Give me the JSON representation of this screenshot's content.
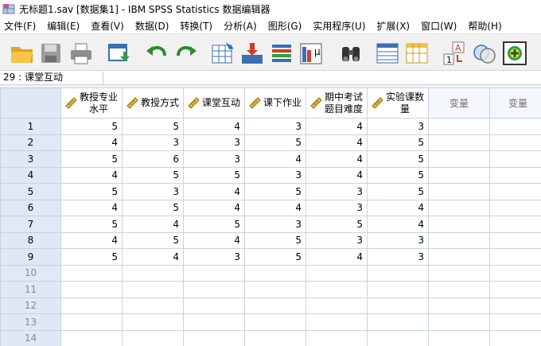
{
  "window": {
    "title": "无标题1.sav [数据集1] - IBM SPSS Statistics 数据编辑器"
  },
  "menu": [
    {
      "label": "文件(F)"
    },
    {
      "label": "编辑(E)"
    },
    {
      "label": "查看(V)"
    },
    {
      "label": "数据(D)"
    },
    {
      "label": "转换(T)"
    },
    {
      "label": "分析(A)"
    },
    {
      "label": "图形(G)"
    },
    {
      "label": "实用程序(U)"
    },
    {
      "label": "扩展(X)"
    },
    {
      "label": "窗口(W)"
    },
    {
      "label": "帮助(H)"
    }
  ],
  "toolbar": [
    {
      "icon": "open-folder-icon"
    },
    {
      "icon": "save-disk-icon"
    },
    {
      "icon": "print-icon"
    },
    {
      "icon": "recall-dialog-icon"
    },
    {
      "icon": "undo-icon"
    },
    {
      "icon": "redo-icon"
    },
    {
      "icon": "go-to-case-icon"
    },
    {
      "icon": "go-to-variable-icon"
    },
    {
      "icon": "variables-icon"
    },
    {
      "icon": "run-descriptives-icon"
    },
    {
      "icon": "find-binoculars-icon"
    },
    {
      "icon": "insert-cases-icon"
    },
    {
      "icon": "insert-variable-icon"
    },
    {
      "icon": "value-labels-icon"
    },
    {
      "icon": "use-sets-icon"
    },
    {
      "icon": "spelling-icon"
    }
  ],
  "cell_editor": {
    "reference": "29 : 课堂互动",
    "value": ""
  },
  "sheet": {
    "columns": [
      {
        "label": "教授专业\n水平",
        "scale": true
      },
      {
        "label": "教授方式",
        "scale": true
      },
      {
        "label": "课堂互动",
        "scale": true
      },
      {
        "label": "课下作业",
        "scale": true
      },
      {
        "label": "期中考试\n题目难度",
        "scale": true
      },
      {
        "label": "实验课数\n量",
        "scale": true
      },
      {
        "label": "变量",
        "scale": false
      },
      {
        "label": "变量",
        "scale": false
      }
    ],
    "rows": [
      {
        "num": "1",
        "cells": [
          "5",
          "5",
          "4",
          "3",
          "4",
          "3"
        ]
      },
      {
        "num": "2",
        "cells": [
          "4",
          "3",
          "3",
          "5",
          "4",
          "5"
        ]
      },
      {
        "num": "3",
        "cells": [
          "5",
          "6",
          "3",
          "4",
          "4",
          "5"
        ]
      },
      {
        "num": "4",
        "cells": [
          "4",
          "5",
          "5",
          "3",
          "4",
          "5"
        ]
      },
      {
        "num": "5",
        "cells": [
          "5",
          "3",
          "4",
          "5",
          "3",
          "5"
        ]
      },
      {
        "num": "6",
        "cells": [
          "4",
          "5",
          "4",
          "4",
          "3",
          "4"
        ]
      },
      {
        "num": "7",
        "cells": [
          "5",
          "4",
          "5",
          "3",
          "5",
          "4"
        ]
      },
      {
        "num": "8",
        "cells": [
          "4",
          "5",
          "4",
          "5",
          "3",
          "3"
        ]
      },
      {
        "num": "9",
        "cells": [
          "5",
          "4",
          "3",
          "5",
          "4",
          "3"
        ]
      },
      {
        "num": "10",
        "cells": []
      },
      {
        "num": "11",
        "cells": []
      },
      {
        "num": "12",
        "cells": []
      },
      {
        "num": "13",
        "cells": []
      },
      {
        "num": "14",
        "cells": []
      }
    ]
  }
}
